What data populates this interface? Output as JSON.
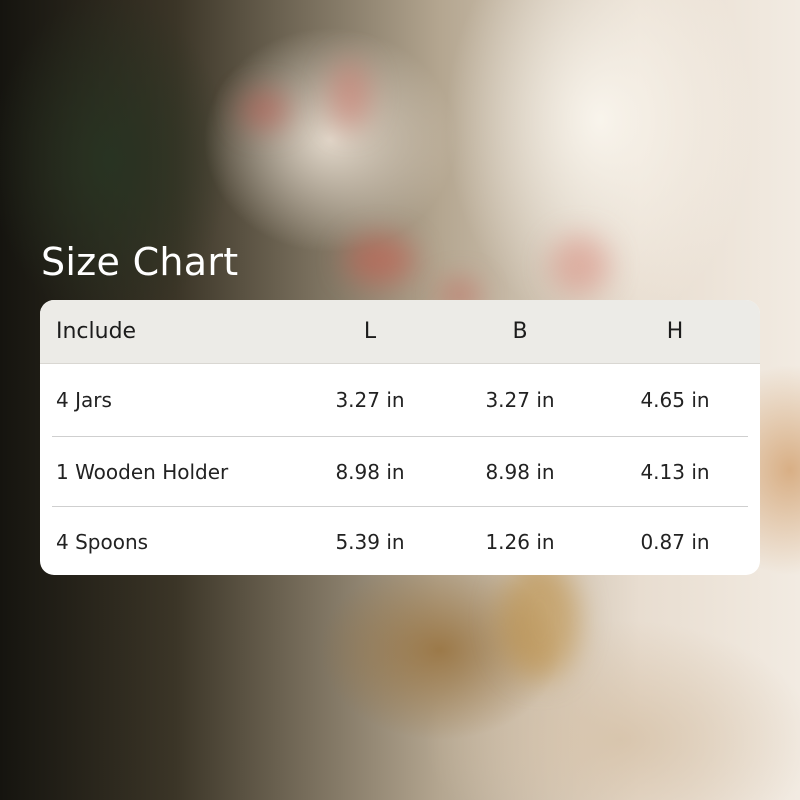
{
  "title": "Size Chart",
  "table": {
    "headers": [
      "Include",
      "L",
      "B",
      "H"
    ],
    "rows": [
      [
        "4 Jars",
        "3.27 in",
        "3.27 in",
        "4.65 in"
      ],
      [
        "1 Wooden Holder",
        "8.98 in",
        "8.98 in",
        "4.13 in"
      ],
      [
        "4 Spoons",
        "5.39 in",
        "1.26 in",
        "0.87 in"
      ]
    ]
  },
  "colors": {
    "title_text": "#ffffff",
    "header_background": "#ecebe7",
    "table_background": "#ffffff",
    "cell_text": "#222222",
    "divider": "#cfcfcf"
  }
}
